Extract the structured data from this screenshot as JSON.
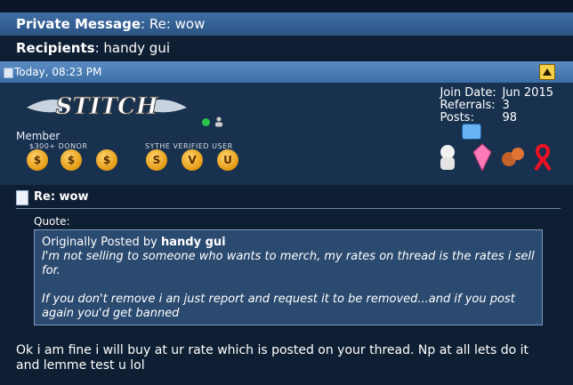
{
  "title_bar": {
    "label": "Private Message",
    "separator": ": ",
    "subject": "Re: wow"
  },
  "recipients": {
    "label": "Recipients",
    "separator": ": ",
    "value": "handy gui"
  },
  "post_header": {
    "date": "Today, 08:23 PM"
  },
  "user": {
    "signature_text": "STITCH",
    "member_label": "Member",
    "award_captions": {
      "donor": "$300+ DONOR",
      "verified": "SYTHE VERIFIED USER"
    },
    "join_date_label": "Join Date:",
    "join_date": "Jun 2015",
    "referrals_label": "Referrals:",
    "referrals": "3",
    "posts_label": "Posts:",
    "posts": "98"
  },
  "message": {
    "title": "Re: wow",
    "quote_label": "Quote:",
    "quote_prefix": "Originally Posted by",
    "quote_author": "handy gui",
    "quote_line1": "I'm not selling to someone who wants to merch, my rates on thread is the rates i sell for.",
    "quote_line2": "If you don't remove i an just report and request it to be removed...and if you post again you'd get banned",
    "body": "Ok i am fine i will buy at ur rate which is posted on your thread. Np at all lets do it and lemme test u lol"
  },
  "icons": [
    "document-icon",
    "warning-icon",
    "online-status-icon",
    "person-icon",
    "skype-icon"
  ]
}
